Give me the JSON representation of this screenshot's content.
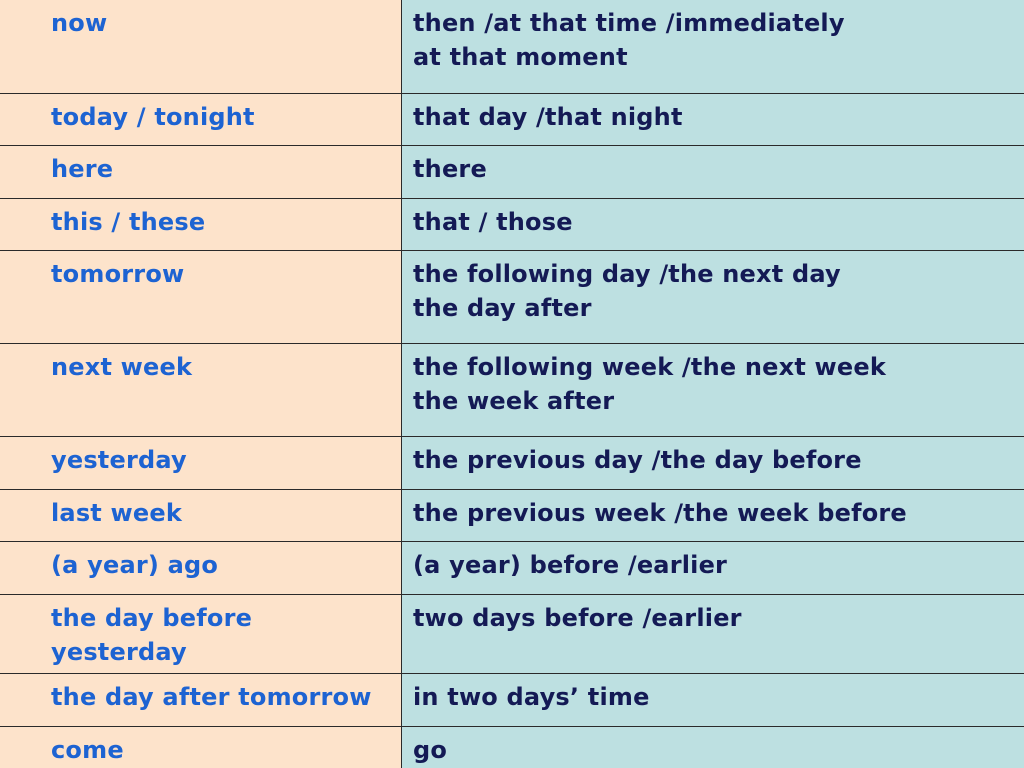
{
  "colors": {
    "left_bg": "#fde3cb",
    "right_bg": "#bde0e1",
    "left_text": "#1d63d2",
    "right_text": "#141a55"
  },
  "rows": [
    {
      "direct": [
        "now"
      ],
      "reported": [
        "then /at that time /immediately",
        "at that moment"
      ]
    },
    {
      "direct": [
        "today / tonight"
      ],
      "reported": [
        "that day /that night"
      ]
    },
    {
      "direct": [
        "here"
      ],
      "reported": [
        "there"
      ]
    },
    {
      "direct": [
        "this / these"
      ],
      "reported": [
        "that / those"
      ]
    },
    {
      "direct": [
        "tomorrow"
      ],
      "reported": [
        "the following day /the next day",
        "the day after"
      ]
    },
    {
      "direct": [
        "next week"
      ],
      "reported": [
        "the following week /the next week",
        "the week after"
      ]
    },
    {
      "direct": [
        "yesterday"
      ],
      "reported": [
        "the previous day /the day before"
      ]
    },
    {
      "direct": [
        "last week"
      ],
      "reported": [
        "the previous week /the week before"
      ]
    },
    {
      "direct": [
        "(a year) ago"
      ],
      "reported": [
        "(a year) before /earlier"
      ]
    },
    {
      "direct": [
        "the day before",
        "yesterday"
      ],
      "reported": [
        "two days before /earlier"
      ]
    },
    {
      "direct": [
        "the day after tomorrow"
      ],
      "reported": [
        "in two days’ time"
      ]
    },
    {
      "direct": [
        "come"
      ],
      "reported": [
        "go"
      ]
    }
  ]
}
